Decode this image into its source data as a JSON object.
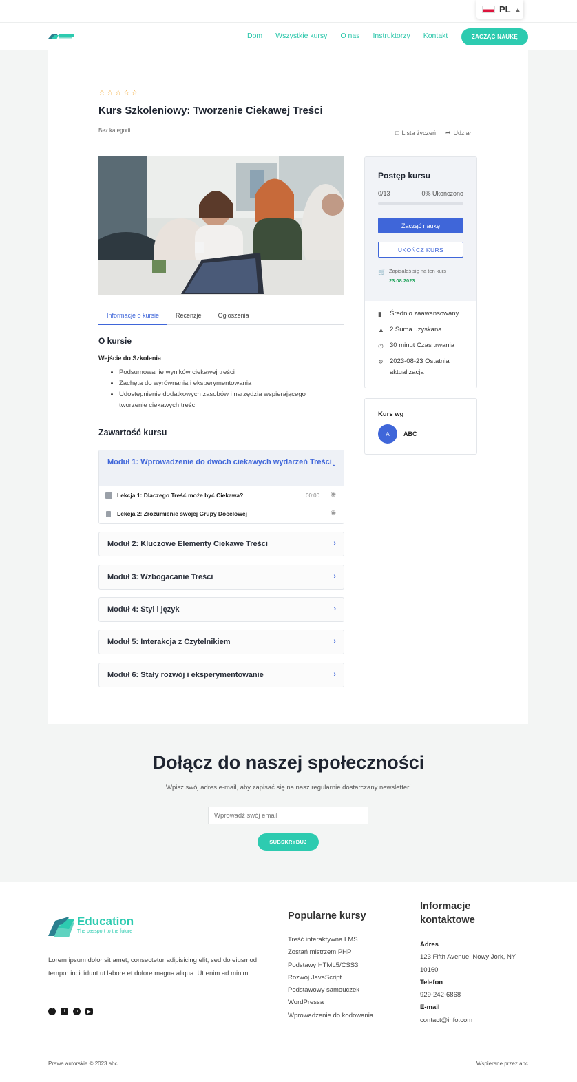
{
  "language": {
    "code": "PL",
    "flag": "poland-flag",
    "caret": "^"
  },
  "header": {
    "logo_text": "Education",
    "nav": [
      "Dom",
      "Wszystkie kursy",
      "O nas",
      "Instruktorzy",
      "Kontakt"
    ],
    "cta": "ZACZĄĆ NAUKĘ"
  },
  "course": {
    "rating_stars": 5,
    "rating_value": 0,
    "title": "Kurs Szkoleniowy: Tworzenie Ciekawej Treści",
    "category": "Bez kategorii",
    "wishlist": "Lista życzeń",
    "share": "Udział",
    "tabs": [
      "Informacje o kursie",
      "Recenzje",
      "Ogłoszenia"
    ],
    "about_heading": "O kursie",
    "intro_heading": "Wejście do Szkolenia",
    "bullets": [
      "Podsumowanie wyników ciekawej treści",
      "Zachęta do wyrównania i eksperymentowania",
      "Udostępnienie dodatkowych zasobów i narzędzia wspierającego tworzenie ciekawych treści"
    ],
    "content_heading": "Zawartość kursu",
    "modules": [
      {
        "title": "Moduł 1: Wprowadzenie do dwóch ciekawych wydarzeń Treści",
        "expanded": true,
        "lessons": [
          {
            "title": "Lekcja 1: Dlaczego Treść może być Ciekawa?",
            "time": "00:00",
            "icon": "video-icon"
          },
          {
            "title": "Lekcja 2: Zrozumienie swojej Grupy Docelowej",
            "time": "",
            "icon": "document-icon"
          }
        ]
      },
      {
        "title": "Moduł 2: Kluczowe Elementy Ciekawe Treści"
      },
      {
        "title": "Moduł 3: Wzbogacanie Treści"
      },
      {
        "title": "Moduł 4: Styl i język"
      },
      {
        "title": "Moduł 5: Interakcja z Czytelnikiem"
      },
      {
        "title": "Moduł 6: Stały rozwój i eksperymentowanie"
      }
    ]
  },
  "progress": {
    "title": "Postęp kursu",
    "count": "0/13",
    "percent_label": "0% Ukończono",
    "percent": 0,
    "start_button": "Zacząć naukę",
    "finish_button": "UKOŃCZ KURS",
    "enrolled_text": "Zapisałeś się na ten kurs",
    "enrolled_date": "23.08.2023",
    "meta": [
      {
        "icon": "level-icon",
        "text": "Średnio zaawansowany"
      },
      {
        "icon": "graduation-icon",
        "text": "2 Suma uzyskana"
      },
      {
        "icon": "clock-icon",
        "text": "30 minut  Czas trwania"
      },
      {
        "icon": "refresh-icon",
        "text": "2023-08-23 Ostatnia aktualizacja"
      }
    ]
  },
  "author": {
    "heading": "Kurs wg",
    "initial": "A",
    "name": "ABC"
  },
  "newsletter": {
    "title": "Dołącz do naszej społeczności",
    "subtitle": "Wpisz swój adres e-mail, aby zapisać się na nasz regularnie dostarczany newsletter!",
    "placeholder": "Wprowadź swój email",
    "button": "SUBSKRYBUJ"
  },
  "footer": {
    "logo_text": "Education",
    "logo_tagline": "The passport to the future",
    "description": "Lorem ipsum dolor sit amet, consectetur adipisicing elit, sed do eiusmod tempor incididunt ut labore et dolore magna aliqua. Ut enim ad minim.",
    "social": [
      "facebook-icon",
      "twitter-icon",
      "pinterest-icon",
      "youtube-icon"
    ],
    "popular_heading": "Popularne kursy",
    "popular": [
      "Treść interaktywna LMS",
      "Zostań mistrzem PHP",
      "Podstawy HTML5/CSS3",
      "Rozwój JavaScript",
      "Podstawowy samouczek WordPressa",
      "Wprowadzenie do kodowania"
    ],
    "contact_heading": "Informacje kontaktowe",
    "address_label": "Adres",
    "address": "123 Fifth Avenue, Nowy Jork, NY 10160",
    "phone_label": "Telefon",
    "phone": "929-242-6868",
    "email_label": "E-mail",
    "email": "contact@info.com",
    "copyright": "Prawa autorskie © 2023 abc",
    "powered": "Wspierane przez abc"
  },
  "colors": {
    "accent": "#2dcbb0",
    "primary": "#3f66d9",
    "enrolled": "#21a35b",
    "star": "#f0a020"
  }
}
